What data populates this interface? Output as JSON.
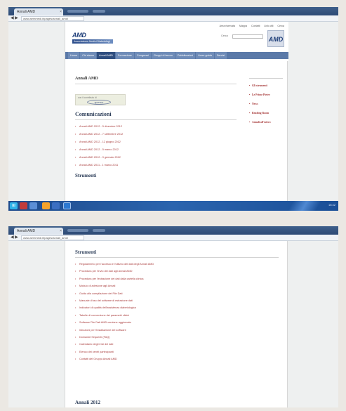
{
  "browser": {
    "tab_title": "Annali AMD",
    "tab_close": "×",
    "url": "www.aemmedi.it/pages/annali_amd/",
    "nav_arrows": "◀ ▶"
  },
  "site": {
    "toplinks": [
      "Area riservata",
      "Mappa",
      "Contatti",
      "Link utili",
      "Cerca"
    ],
    "logo_text": "AMD",
    "logo_subtitle": "Associazione Medici Diabetologi",
    "search_label": "Cerca",
    "logo_right": "AMD",
    "menu": [
      "Home",
      "Chi siamo",
      "Annali AMD",
      "Formazione",
      "Congressi",
      "Gruppi di lavoro",
      "Pubblicazioni",
      "Linee guida",
      "Servizi"
    ],
    "menu_active_index": 2
  },
  "main": {
    "page_title": "Annali AMD",
    "ad_line": "con il contributo di",
    "ad_logo": "sponsor",
    "section1_title": "Comunicazioni",
    "section1_links": [
      "Annali AMD 2012 - 5 dicembre 2012",
      "Annali AMD 2012 - 7 settembre 2012",
      "Annali AMD 2012 - 12 giugno 2012",
      "Annali AMD 2012 - 5 marzo 2012",
      "Annali AMD 2012 - 9 gennaio 2012",
      "Annali AMD 2011 - 1 marzo 2011"
    ],
    "section2_title": "Strumenti"
  },
  "sidebar": {
    "items": [
      "Gli strumenti",
      "Le Prime Pietre",
      "News",
      "Reading Room",
      "Annali all'estero"
    ]
  },
  "taskbar": {
    "start": "⊞",
    "tray": "16:42"
  },
  "page2": {
    "section_title": "Strumenti",
    "links": [
      "Regolamento per l'accesso e l'utilizzo dei dati degli Annali AMD",
      "Procedura per l'invio dei dati agli Annali AMD",
      "Procedura per l'estrazione dei dati dalla cartella clinica",
      "Modulo di adesione agli Annali",
      "Guida alla compilazione del File Dati",
      "Manuale d'uso del software di estrazione dati",
      "Indicatori di qualità dell'assistenza diabetologica",
      "Tabelle di conversione dei parametri clinici",
      "Software File Dati AMD versione aggiornata",
      "Istruzioni per l'installazione del software",
      "Domande frequenti (FAQ)",
      "Calendario degli invii dei dati",
      "Elenco dei centri partecipanti",
      "Contatti del Gruppo Annali AMD"
    ],
    "section2_title": "Annali 2012"
  }
}
